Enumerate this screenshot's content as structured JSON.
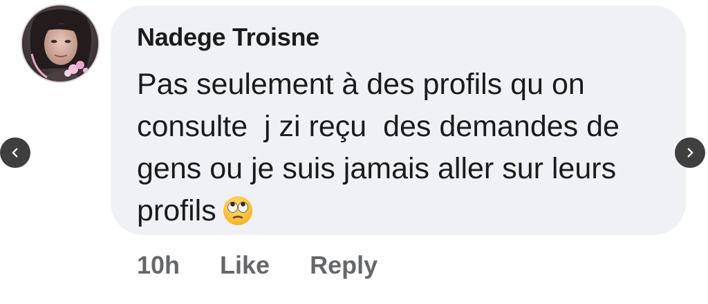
{
  "comment": {
    "author": "Nadege Troisne",
    "line1": "Pas seulement à des profils qu on",
    "line2": "consulte  j zi reçu  des demandes de",
    "line3": "gens ou je suis jamais aller sur leurs",
    "line4": "profils",
    "emoji": "face-with-rolling-eyes"
  },
  "actions": {
    "time": "10h",
    "like_label": "Like",
    "reply_label": "Reply"
  },
  "navigation": {
    "prev_icon": "chevron-left-icon",
    "next_icon": "chevron-right-icon"
  },
  "colors": {
    "bubble_bg": "#f0f1f5",
    "text": "#1b1b1b",
    "action_text": "#65676b",
    "nav_button_bg": "#3f3f3f"
  }
}
